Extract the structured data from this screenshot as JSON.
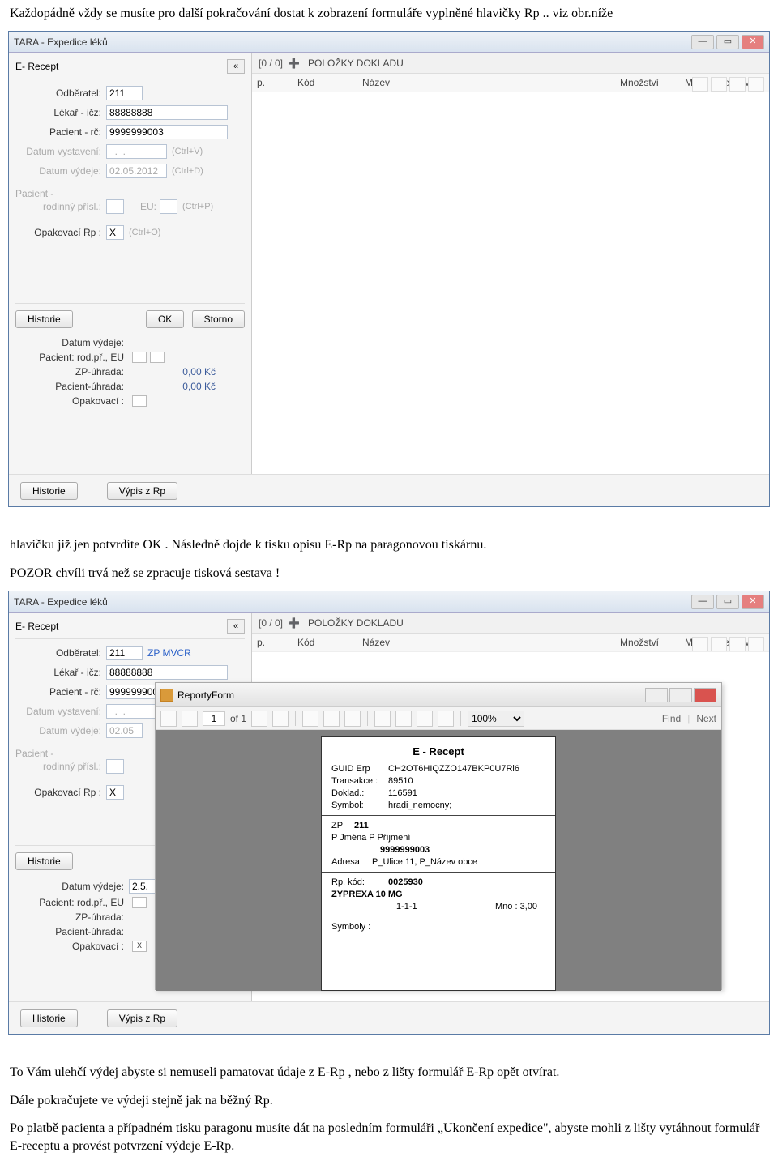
{
  "doc": {
    "para1": "Každopádně vždy se musíte pro další pokračování dostat k zobrazení formuláře vyplněné hlavičky Rp .. viz obr.níže",
    "para2a": "hlavičku již jen potvrdíte OK .  Následně dojde k tisku opisu E-Rp na paragonovou tiskárnu.",
    "para2b": "POZOR chvíli trvá než se zpracuje tisková sestava !",
    "para3": "To Vám ulehčí výdej abyste si nemuseli pamatovat údaje z E-Rp , nebo z lišty formulář E-Rp opět otvírat.",
    "para4": "Dále pokračujete  ve výdeji stejně jak na běžný Rp.",
    "para5": "Po platbě pacienta a případném tisku paragonu musíte dát na posledním formuláři „Ukončení expedice\", abyste mohli z lišty vytáhnout formulář E-receptu a provést potvrzení výdeje E-Rp."
  },
  "win": {
    "title": "TARA - Expedice léků",
    "min": "—",
    "max": "▭",
    "close": "✕"
  },
  "panel": {
    "title": "E- Recept",
    "collapse": "«",
    "labels": {
      "odberatel": "Odběratel:",
      "lekar": "Lékař - ičz:",
      "pacient": "Pacient - rč:",
      "datumVystaveni": "Datum vystavení:",
      "datumVydeje": "Datum výdeje:",
      "pacientSub": "Pacient -",
      "rodPr": "rodinný přísl.:",
      "eu": "EU:",
      "opak": "Opakovací Rp :"
    },
    "values": {
      "odberatel": "211",
      "odberatel_link": "ZP MVCR",
      "lekar": "88888888",
      "pacient": "9999999003",
      "datumVystaveni": "  .  .",
      "datumVydeje1": "02.05.2012",
      "datumVydeje2": "02.05",
      "opak": "X"
    },
    "hints": {
      "ctrlV": "(Ctrl+V)",
      "ctrlD": "(Ctrl+D)",
      "ctrlP": "(Ctrl+P)",
      "ctrlO": "(Ctrl+O)"
    },
    "buttons": {
      "historie": "Historie",
      "ok": "OK",
      "storno": "Storno",
      "vypis": "Výpis z Rp"
    }
  },
  "under": {
    "datumVydeje": "Datum výdeje:",
    "datumVydejeVal": "2.5.",
    "pacRodEU": "Pacient: rod.př., EU",
    "zpuhrada": "ZP-úhrada:",
    "pacuhrada": "Pacient-úhrada:",
    "opak": "Opakovací :",
    "opakX": "X",
    "kc": "0,00 Kč"
  },
  "rp": {
    "polozky": "POLOŽKY DOKLADU",
    "counter": "[0 / 0]",
    "plus": "➕",
    "headers": {
      "p": "p.",
      "kod": "Kód",
      "nazev": "Název",
      "mnozstvi": "Množství",
      "mj": "MJ",
      "cenamj": "Cena/MJ"
    }
  },
  "rep": {
    "title": "ReportyForm",
    "of": "of 1",
    "page": "1",
    "zoom": "100%",
    "find": "Find",
    "next": "Next"
  },
  "recept": {
    "title": "E - Recept",
    "guidl": "GUID Erp",
    "guid": "CH2OT6HIQZZO147BKP0U7Ri6",
    "transl": "Transakce :",
    "trans": "89510",
    "dokl": "Doklad.:",
    "dok": "116591",
    "syml": "Symbol:",
    "sym": "hradi_nemocny;",
    "zp": "ZP",
    "zpv": "211",
    "pjmena": "P  Jména P  Příjmení",
    "rc": "9999999003",
    "adresal": "Adresa",
    "adresa": "P_Ulice 11, P_Název obce",
    "rpkodl": "Rp.   kód:",
    "rpkod": "0025930",
    "lek": "ZYPREXA 10 MG",
    "davk": "1-1-1",
    "mnol": "Mno :",
    "mno": "3,00",
    "symb": "Symboly :"
  }
}
